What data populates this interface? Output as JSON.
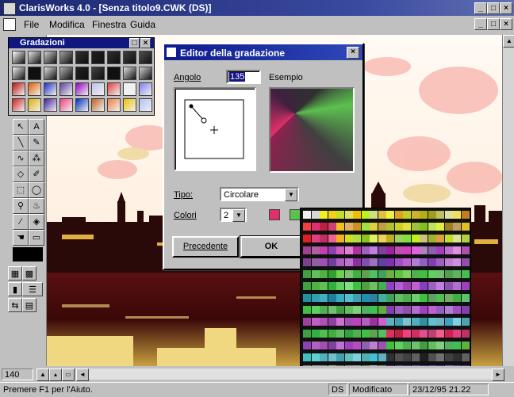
{
  "app": {
    "title": "ClarisWorks 4.0 - [Senza titolo9.CWK (DS)]",
    "window_buttons": [
      "_",
      "□",
      "×"
    ],
    "doc_buttons": [
      "_",
      "□",
      "×"
    ]
  },
  "menu": [
    "File",
    "Modifica",
    "Finestra",
    "Guida"
  ],
  "palette": {
    "title": "Gradazioni",
    "buttons": [
      "□",
      "×"
    ],
    "swatches": [
      [
        "#ffffff",
        "#e8e8e8",
        "#d0d0d0",
        "#a0a0a0",
        "#303030",
        "#202020",
        "#303030",
        "#404040",
        "#505050"
      ],
      [
        "#f0f0f0",
        "#101010",
        "#e0e0e0",
        "#b0b0b0",
        "#202020",
        "#404040",
        "#101010",
        "#e0e0e0",
        "#d0d0d0"
      ],
      [
        "#c01010",
        "#e06000",
        "#2030c0",
        "#6040a0",
        "#9000c0",
        "#c0c0f0",
        "#e04040",
        "#f0f0f0",
        "#8080f0"
      ],
      [
        "#d02020",
        "#e0b000",
        "#4020a0",
        "#f04080",
        "#0030c0",
        "#c06020",
        "#f08040",
        "#f0c000",
        "#b0c0f0"
      ]
    ]
  },
  "dialog": {
    "title": "Editor della gradazione",
    "close": "×",
    "angle_label": "Angolo",
    "angle_value": "135",
    "example_label": "Esempio",
    "type_label": "Tipo:",
    "type_value": "Circolare",
    "colors_label": "Colori",
    "colors_value": "2",
    "color1": "#e0306a",
    "color2": "#5cc050",
    "prev_button": "Precedente",
    "ok_button": "OK"
  },
  "color_grid": {
    "rows": [
      [
        "#f0f0f0",
        "#d8d8d8",
        "#f0f020",
        "#f0d020",
        "#c0e020",
        "#e0e060",
        "#f0c000",
        "#c0f020",
        "#d0e080",
        "#e0c040",
        "#f0f040",
        "#e0a020",
        "#c0d020",
        "#d0b030",
        "#b0b010",
        "#a0a020",
        "#c0c060",
        "#e0e0a0",
        "#f0e060",
        "#c08020"
      ],
      [
        "#f04040",
        "#e03070",
        "#c02040",
        "#d04070",
        "#f0c020",
        "#e0b060",
        "#d09020",
        "#a0e040",
        "#e0d040",
        "#c0a040",
        "#b0c030",
        "#d0d020",
        "#e0e040",
        "#a0c040",
        "#80c020",
        "#c0e060",
        "#e0f040",
        "#a08020",
        "#c0a060",
        "#e0c020"
      ],
      [
        "#e02020",
        "#e04080",
        "#c03060",
        "#f06090",
        "#f0b020",
        "#d0e020",
        "#b0e040",
        "#90c020",
        "#e0f060",
        "#f0d060",
        "#c0b020",
        "#a0d060",
        "#80e040",
        "#c0f020",
        "#d0c080",
        "#a0b030",
        "#e0a040",
        "#c0e020",
        "#e0e0a0",
        "#b0d040"
      ],
      [
        "#a04090",
        "#b060a0",
        "#c040b0",
        "#9040b0",
        "#d060c0",
        "#e080d0",
        "#b030a0",
        "#a060c0",
        "#c080e0",
        "#8040a0",
        "#a020a0",
        "#c050b0",
        "#d040c0",
        "#e060e0",
        "#b080c0",
        "#9060b0",
        "#a040c0",
        "#c070d0",
        "#e090e0",
        "#b050b0"
      ],
      [
        "#804090",
        "#9060a0",
        "#a050b0",
        "#7040a0",
        "#b060c0",
        "#c070d0",
        "#9030a0",
        "#8050b0",
        "#a070c0",
        "#6040a0",
        "#8030b0",
        "#a050c0",
        "#c060d0",
        "#b080d0",
        "#9060c0",
        "#8040b0",
        "#a060c0",
        "#c080d0",
        "#d090e0",
        "#9050b0"
      ],
      [
        "#40a040",
        "#60c060",
        "#50b040",
        "#30a030",
        "#70d050",
        "#80c070",
        "#40b040",
        "#60a050",
        "#50c060",
        "#40a060",
        "#70b040",
        "#60c040",
        "#80d060",
        "#50b050",
        "#40c040",
        "#60d060",
        "#70c070",
        "#50a050",
        "#60b060",
        "#40c050"
      ],
      [
        "#40a040",
        "#50b040",
        "#60c050",
        "#30b040",
        "#60d060",
        "#80e080",
        "#40c040",
        "#50a040",
        "#70c060",
        "#40b050",
        "#9040c0",
        "#b060d0",
        "#a040b0",
        "#c060d0",
        "#8040c0",
        "#a060c0",
        "#c080e0",
        "#9050b0",
        "#b070d0",
        "#a040c0"
      ],
      [
        "#2090a0",
        "#30a0b0",
        "#40b0c0",
        "#2080a0",
        "#30b0c0",
        "#50c0d0",
        "#40a0b0",
        "#2090b0",
        "#3080a0",
        "#40b0a0",
        "#40a060",
        "#60c060",
        "#50b050",
        "#70d070",
        "#40c040",
        "#60a060",
        "#50c050",
        "#70b060",
        "#40b040",
        "#60c070"
      ],
      [
        "#40c040",
        "#60d060",
        "#50b050",
        "#70c070",
        "#40a040",
        "#60c060",
        "#80d080",
        "#50b060",
        "#40c050",
        "#60b040",
        "#8040b0",
        "#a060c0",
        "#9050b0",
        "#b070d0",
        "#a040c0",
        "#c060d0",
        "#9060c0",
        "#b080d0",
        "#a050c0",
        "#8040b0"
      ],
      [
        "#a040a0",
        "#c060c0",
        "#b050b0",
        "#9040a0",
        "#d070d0",
        "#a050b0",
        "#c040c0",
        "#b060c0",
        "#a030a0",
        "#d060d0",
        "#60b0c0",
        "#40a0b0",
        "#80c0d0",
        "#50b0c0",
        "#3090a0",
        "#60c0d0",
        "#70b0c0",
        "#40a0c0",
        "#80d0e0",
        "#50a0b0"
      ],
      [
        "#40a040",
        "#30b040",
        "#50c050",
        "#40b040",
        "#60c060",
        "#30a040",
        "#50b050",
        "#40c040",
        "#60a050",
        "#50c060",
        "#e03060",
        "#c02040",
        "#f04080",
        "#d03060",
        "#e05090",
        "#c04070",
        "#f06090",
        "#d02050",
        "#e04080",
        "#c03060"
      ],
      [
        "#9040b0",
        "#b060c0",
        "#a050b0",
        "#8040a0",
        "#c070d0",
        "#a040c0",
        "#b050c0",
        "#9060b0",
        "#c080d0",
        "#a050b0",
        "#40c040",
        "#60d060",
        "#50b050",
        "#70c070",
        "#40a040",
        "#60c060",
        "#80d080",
        "#50b060",
        "#40c050",
        "#60b040"
      ],
      [
        "#40c0c0",
        "#60d0d0",
        "#50b0c0",
        "#70c0d0",
        "#40a0b0",
        "#60c0c0",
        "#80d0e0",
        "#50b0b0",
        "#40c0d0",
        "#60b0c0",
        "#303030",
        "#505050",
        "#404040",
        "#606060",
        "#202020",
        "#505050",
        "#707070",
        "#404040",
        "#303030",
        "#606060"
      ],
      [
        "#808080",
        "#a0a0a0",
        "#909090",
        "#b0b0b0",
        "#707070",
        "#909090",
        "#a0a0a0",
        "#808080",
        "#c0c0c0",
        "#909090",
        "#5030a0",
        "#7050b0",
        "#6040a0",
        "#8060c0",
        "#5040b0",
        "#7050c0",
        "#6030b0",
        "#8070d0",
        "#6050b0",
        "#7040a0"
      ]
    ]
  },
  "toolbox": {
    "zoom": "140"
  },
  "status": {
    "help": "Premere F1 per l'Aiuto.",
    "mode": "DS",
    "state": "Modificato",
    "datetime": "23/12/95 21.22"
  }
}
